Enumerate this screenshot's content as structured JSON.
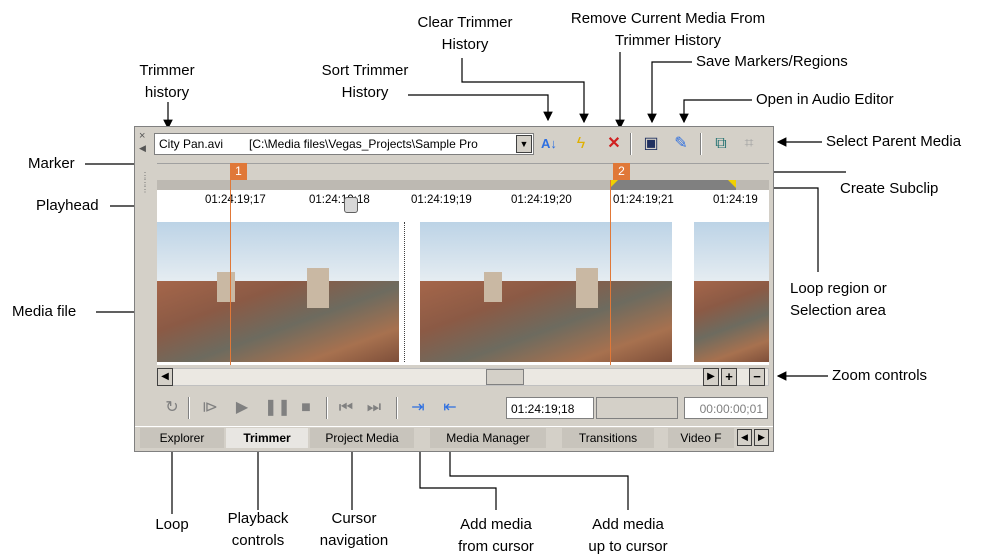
{
  "callouts": {
    "trimmer_history": "Trimmer\nhistory",
    "sort_trimmer_history": "Sort Trimmer\nHistory",
    "clear_trimmer_history": "Clear Trimmer\nHistory",
    "remove_current_media": "Remove Current Media From\nTrimmer History",
    "save_markers_regions": "Save Markers/Regions",
    "open_in_audio_editor": "Open in Audio Editor",
    "select_parent_media": "Select Parent Media",
    "create_subclip": "Create Subclip",
    "marker": "Marker",
    "playhead": "Playhead",
    "media_file": "Media file",
    "loop_region": "Loop region or\nSelection area",
    "zoom_controls": "Zoom controls",
    "loop": "Loop",
    "playback_controls": "Playback\ncontrols",
    "cursor_navigation": "Cursor\nnavigation",
    "add_media_from_cursor": "Add media\nfrom cursor",
    "add_media_up_to_cursor": "Add media\nup to cursor"
  },
  "trimmer": {
    "history_file": "City Pan.avi",
    "history_path": "[C:\\Media files\\Vegas_Projects\\Sample Pro",
    "marker1": "1",
    "marker2": "2",
    "ruler_ticks": [
      "01:24:19;17",
      "01:24:19;18",
      "01:24:19;19",
      "01:24:19;20",
      "01:24:19;21",
      "01:24:19"
    ],
    "cursor_timecode": "01:24:19;18",
    "selection_length": "00:00:00;01",
    "tabs": [
      "Explorer",
      "Trimmer",
      "Project Media",
      "Media Manager",
      "Transitions",
      "Video F"
    ],
    "active_tab": "Trimmer"
  },
  "icons": {
    "sort": "sort-icon",
    "clear": "lightning-icon",
    "remove": "close-icon",
    "save": "floppy-icon",
    "audio_editor": "audio-editor-icon",
    "subclip": "subclip-icon",
    "parent": "parent-media-icon"
  },
  "colors": {
    "marker": "#e07838",
    "region_flag": "#f0d000",
    "accent_blue": "#2e6fe0",
    "remove_red": "#d02020"
  }
}
